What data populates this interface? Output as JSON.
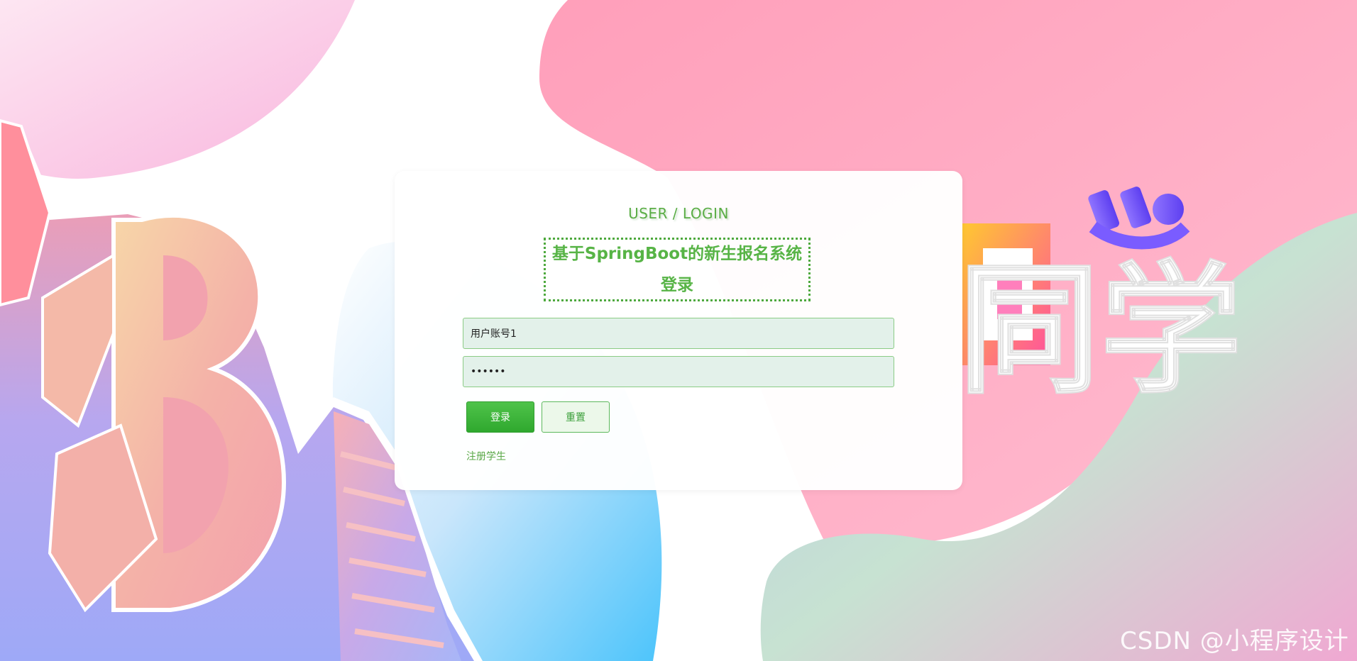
{
  "login": {
    "subtitle": "USER / LOGIN",
    "title": "基于SpringBoot的新生报名系统登录",
    "account_value": "用户账号1",
    "password_value": "••••••",
    "login_button": "登录",
    "reset_button": "重置",
    "register_link": "注册学生"
  },
  "background": {
    "decor_text": "同学"
  },
  "watermark": "CSDN @小程序设计",
  "colors": {
    "accent": "#57b446",
    "button": "#3cb53a",
    "field_bg": "#e3f1ea",
    "pink_blob": "#ffa6c0",
    "blue_blob": "#5cc8f8"
  }
}
